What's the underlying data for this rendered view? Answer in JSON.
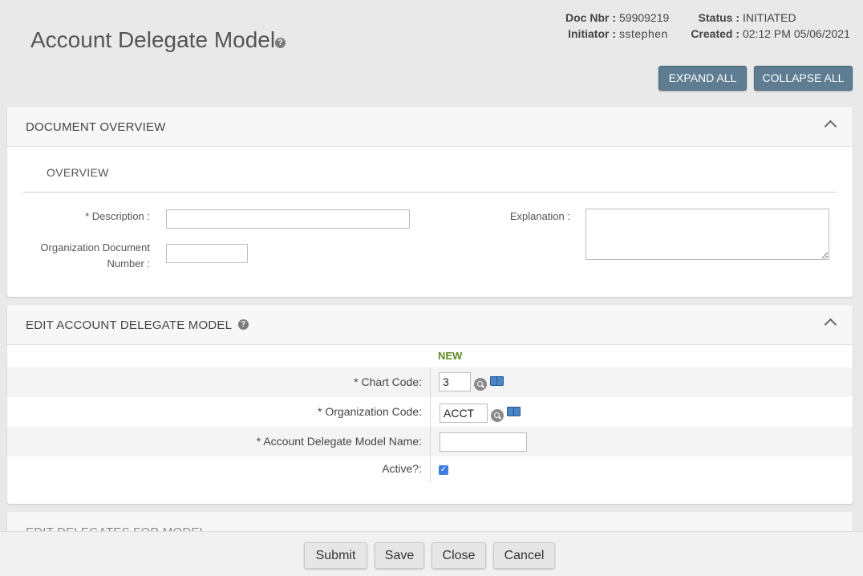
{
  "page": {
    "title": "Account Delegate Model",
    "help_icon_label": "?"
  },
  "doc_info": {
    "doc_nbr_label": "Doc Nbr :",
    "doc_nbr": "59909219",
    "status_label": "Status :",
    "status": "INITIATED",
    "initiator_label": "Initiator :",
    "initiator": "sstephen",
    "created_label": "Created :",
    "created": "02:12 PM 05/06/2021"
  },
  "toolbar": {
    "expand_all": "EXPAND ALL",
    "collapse_all": "COLLAPSE ALL"
  },
  "document_overview": {
    "header": "DOCUMENT OVERVIEW",
    "subheader": "OVERVIEW",
    "description_label": "* Description :",
    "description_value": "",
    "org_doc_number_label_line1": "Organization Document",
    "org_doc_number_label_line2": "Number :",
    "org_doc_number_value": "",
    "explanation_label": "Explanation :",
    "explanation_value": ""
  },
  "edit_model": {
    "header": "EDIT ACCOUNT DELEGATE MODEL",
    "new_label": "NEW",
    "chart_code_label": "* Chart Code:",
    "chart_code_value": "3",
    "org_code_label": "* Organization Code:",
    "org_code_value": "ACCT",
    "model_name_label": "* Account Delegate Model Name:",
    "model_name_value": "",
    "active_label": "Active?:",
    "active_checked": true
  },
  "edit_delegates": {
    "header": "EDIT DELEGATES FOR MODEL"
  },
  "footer": {
    "submit": "Submit",
    "save": "Save",
    "close": "Close",
    "cancel": "Cancel"
  }
}
